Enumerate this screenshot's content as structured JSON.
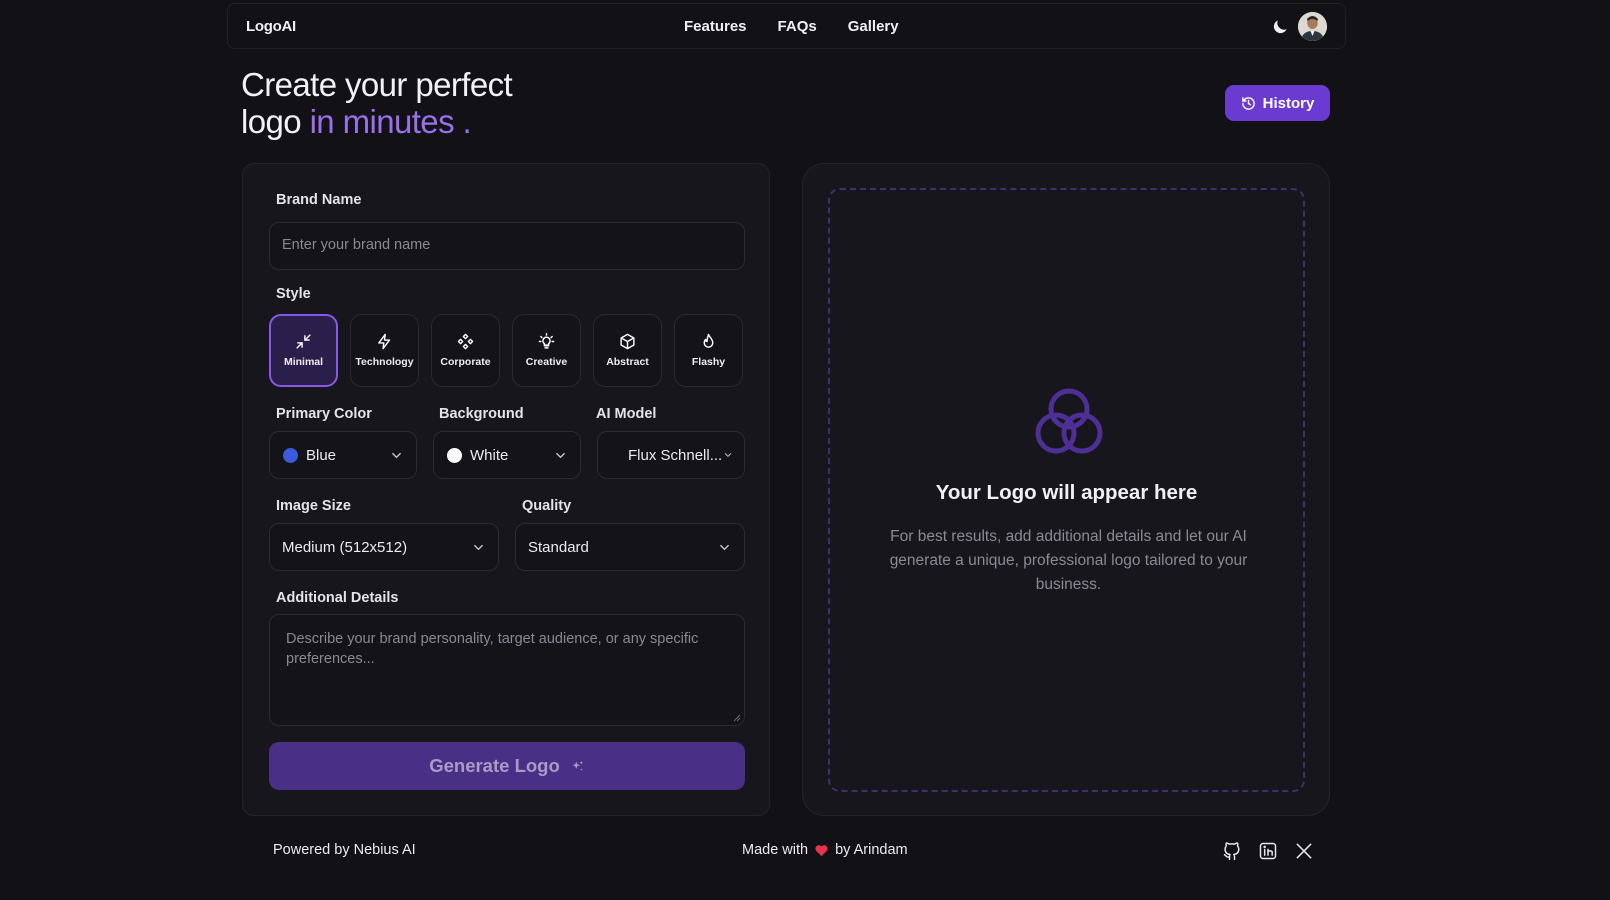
{
  "nav": {
    "brand": "LogoAI",
    "links": [
      "Features",
      "FAQs",
      "Gallery"
    ],
    "theme_icon": "moon-icon",
    "avatar_icon": "user-avatar"
  },
  "hero": {
    "line1": "Create your perfect",
    "line2_plain": "logo ",
    "line2_accent": "in minutes .",
    "history_label": "History",
    "accent_color": "#9a70ea",
    "button_color": "#6a3ad1"
  },
  "form": {
    "brand_label": "Brand Name",
    "brand_placeholder": "Enter your brand name",
    "style_label": "Style",
    "styles": [
      {
        "label": "Minimal",
        "icon": "minimize-icon",
        "selected": true
      },
      {
        "label": "Technology",
        "icon": "lightning-icon",
        "selected": false
      },
      {
        "label": "Corporate",
        "icon": "diamonds-icon",
        "selected": false
      },
      {
        "label": "Creative",
        "icon": "lightbulb-icon",
        "selected": false
      },
      {
        "label": "Abstract",
        "icon": "cube-icon",
        "selected": false
      },
      {
        "label": "Flashy",
        "icon": "flame-icon",
        "selected": false
      }
    ],
    "primary_color_label": "Primary Color",
    "primary_color_value": "Blue",
    "primary_color_swatch": "#3b5bdb",
    "background_label": "Background",
    "background_value": "White",
    "background_swatch": "#ffffff",
    "model_label": "AI Model",
    "model_value": "Flux Schnell...",
    "image_size_label": "Image Size",
    "image_size_value": "Medium (512x512)",
    "quality_label": "Quality",
    "quality_value": "Standard",
    "details_label": "Additional Details",
    "details_placeholder": "Describe your brand personality, target audience, or any specific preferences...",
    "generate_label": "Generate Logo"
  },
  "preview": {
    "title": "Your Logo will appear here",
    "description": "For best results, add additional details and let our AI generate a unique, professional logo tailored to your business."
  },
  "footer": {
    "powered": "Powered by Nebius AI",
    "made_with": "Made with",
    "by": "by Arindam",
    "socials": [
      "github-icon",
      "linkedin-icon",
      "x-icon"
    ]
  }
}
